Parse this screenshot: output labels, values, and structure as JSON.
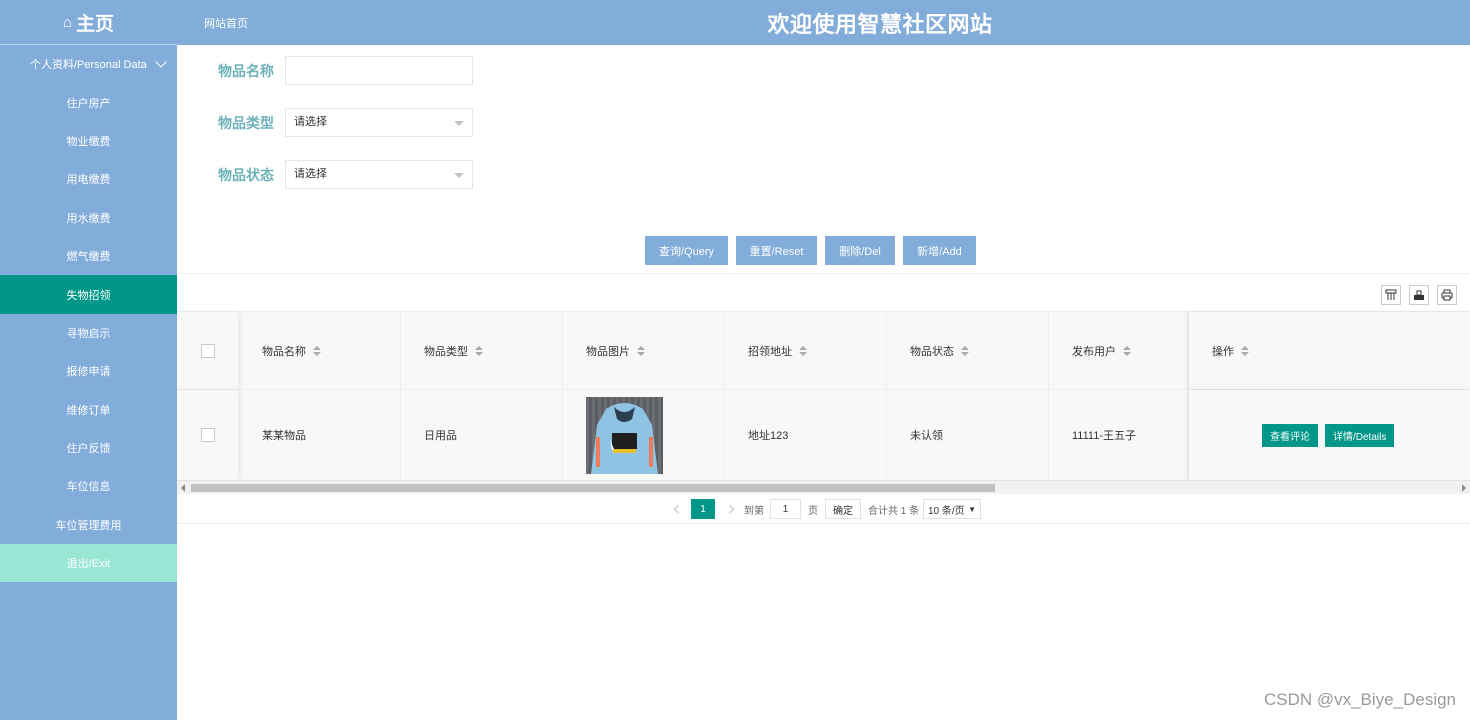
{
  "header": {
    "home_label": "主页",
    "breadcrumb": "网站首页",
    "site_title": "欢迎使用智慧社区网站",
    "color": "#82acd9"
  },
  "sidebar": {
    "items": [
      {
        "label": "个人资料/Personal Data"
      },
      {
        "label": "住户房产"
      },
      {
        "label": "物业缴费"
      },
      {
        "label": "用电缴费"
      },
      {
        "label": "用水缴费"
      },
      {
        "label": "燃气缴费"
      },
      {
        "label": "失物招领"
      },
      {
        "label": "寻物启示"
      },
      {
        "label": "报修申请"
      },
      {
        "label": "维修订单"
      },
      {
        "label": "住户反馈"
      },
      {
        "label": "车位信息"
      },
      {
        "label": "车位管理费用"
      },
      {
        "label": "退出/Exit"
      }
    ],
    "active_color": "#009688",
    "exit_color": "#9ae6d5"
  },
  "form": {
    "name_label": "物品名称",
    "name_value": "",
    "type_label": "物品类型",
    "type_value": "请选择",
    "status_label": "物品状态",
    "status_value": "请选择"
  },
  "actions": {
    "query": "查询/Query",
    "reset": "重置/Reset",
    "del": "删除/Del",
    "add": "新增/Add"
  },
  "table": {
    "columns": [
      "物品名称",
      "物品类型",
      "物品图片",
      "招领地址",
      "物品状态",
      "发布用户",
      "操作"
    ],
    "rows": [
      {
        "name": "某某物品",
        "type": "日用品",
        "image": "hoodie-photo",
        "address": "地址123",
        "status": "未认领",
        "user": "11111-王五子",
        "btn_comment": "查看评论",
        "btn_details": "详情/Details"
      }
    ]
  },
  "pagination": {
    "current": "1",
    "goto_label": "到第",
    "goto_value": "1",
    "page_unit": "页",
    "confirm": "确定",
    "total": "合计共 1 条",
    "page_size": "10 条/页"
  },
  "watermark": "CSDN @vx_Biye_Design"
}
